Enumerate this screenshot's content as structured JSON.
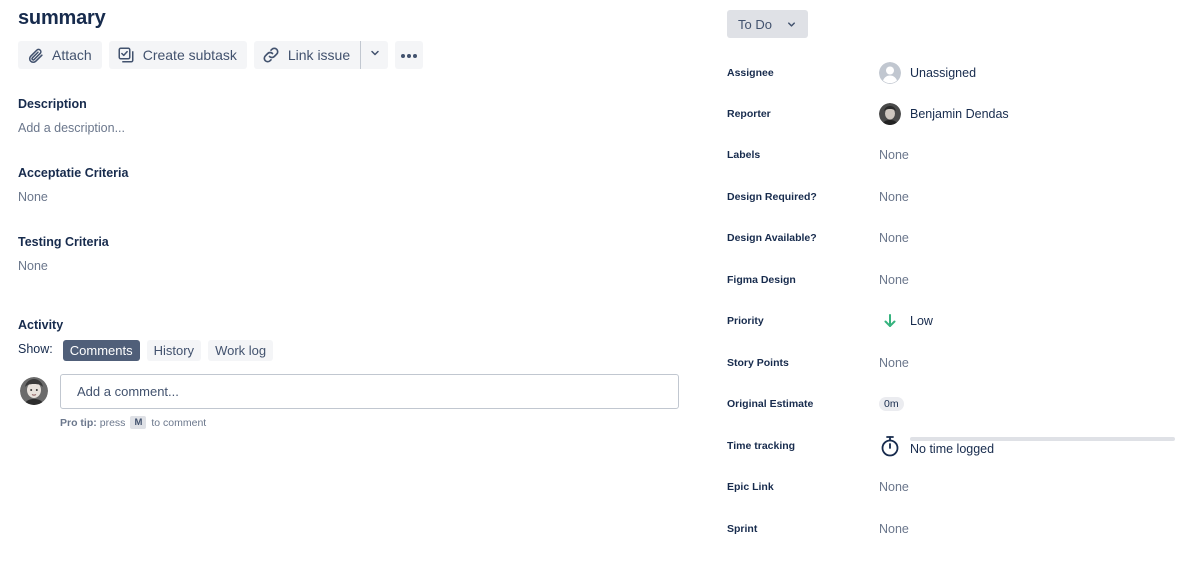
{
  "issue": {
    "title": "summary"
  },
  "toolbar": {
    "attach_label": "Attach",
    "create_subtask_label": "Create subtask",
    "link_issue_label": "Link issue"
  },
  "sections": {
    "description": {
      "heading": "Description",
      "placeholder": "Add a description..."
    },
    "acceptance": {
      "heading": "Acceptatie Criteria",
      "value": "None"
    },
    "testing": {
      "heading": "Testing Criteria",
      "value": "None"
    }
  },
  "activity": {
    "heading": "Activity",
    "show_label": "Show:",
    "tabs": [
      {
        "label": "Comments",
        "active": true
      },
      {
        "label": "History",
        "active": false
      },
      {
        "label": "Work log",
        "active": false
      }
    ],
    "comment_placeholder": "Add a comment...",
    "protip": {
      "prefix": "Pro tip:",
      "press": "press",
      "key": "M",
      "suffix": "to comment"
    }
  },
  "status": {
    "label": "To Do"
  },
  "fields": [
    {
      "label": "Assignee",
      "value": "Unassigned"
    },
    {
      "label": "Reporter",
      "value": "Benjamin Dendas"
    },
    {
      "label": "Labels",
      "value": "None"
    },
    {
      "label": "Design Required?",
      "value": "None"
    },
    {
      "label": "Design Available?",
      "value": "None"
    },
    {
      "label": "Figma Design",
      "value": "None"
    },
    {
      "label": "Priority",
      "value": "Low"
    },
    {
      "label": "Story Points",
      "value": "None"
    },
    {
      "label": "Original Estimate",
      "value": "0m"
    },
    {
      "label": "Time tracking",
      "value": "No time logged"
    },
    {
      "label": "Epic Link",
      "value": "None"
    },
    {
      "label": "Sprint",
      "value": "None"
    }
  ],
  "colors": {
    "priority_low": "#36b37e",
    "active_tab": "#505f79",
    "text_primary": "#172b4d",
    "text_subtle": "#6b778c"
  },
  "icons": {
    "attach": "paperclip-icon",
    "subtask": "checkbox-stack-icon",
    "link": "link-icon",
    "more": "ellipsis-icon",
    "dropdown": "chevron-down-icon",
    "unassigned": "person-placeholder-icon",
    "priority": "arrow-down-icon",
    "time_tracking": "stopwatch-icon"
  }
}
